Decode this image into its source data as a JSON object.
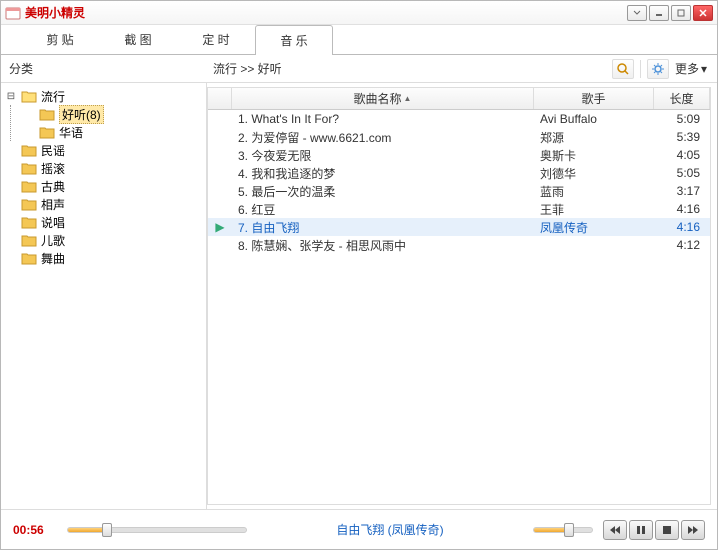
{
  "window": {
    "title": "美明小精灵"
  },
  "tabs": [
    {
      "label": "剪 贴",
      "active": false
    },
    {
      "label": "截 图",
      "active": false
    },
    {
      "label": "定 时",
      "active": false
    },
    {
      "label": "音 乐",
      "active": true
    }
  ],
  "toolbar": {
    "category_label": "分类",
    "breadcrumb": "流行 >> 好听",
    "more_label": "更多"
  },
  "tree": [
    {
      "label": "流行",
      "expanded": true,
      "children": [
        {
          "label": "好听(8)",
          "selected": true
        },
        {
          "label": "华语"
        }
      ]
    },
    {
      "label": "民谣"
    },
    {
      "label": "摇滚"
    },
    {
      "label": "古典"
    },
    {
      "label": "相声"
    },
    {
      "label": "说唱"
    },
    {
      "label": "儿歌"
    },
    {
      "label": "舞曲"
    }
  ],
  "columns": {
    "name": "歌曲名称",
    "artist": "歌手",
    "length": "长度"
  },
  "songs": [
    {
      "n": "1.",
      "name": "What's In It For?",
      "artist": "Avi Buffalo",
      "len": "5:09"
    },
    {
      "n": "2.",
      "name": "为爱停留 - www.6621.com",
      "artist": "郑源",
      "len": "5:39"
    },
    {
      "n": "3.",
      "name": "今夜爱无限",
      "artist": "奥斯卡",
      "len": "4:05"
    },
    {
      "n": "4.",
      "name": "我和我追逐的梦",
      "artist": "刘德华",
      "len": "5:05"
    },
    {
      "n": "5.",
      "name": "最后一次的温柔",
      "artist": "蓝雨",
      "len": "3:17"
    },
    {
      "n": "6.",
      "name": "红豆",
      "artist": "王菲",
      "len": "4:16"
    },
    {
      "n": "7.",
      "name": "自由飞翔",
      "artist": "凤凰传奇",
      "len": "4:16",
      "selected": true,
      "playing": true
    },
    {
      "n": "8.",
      "name": "陈慧娴、张学友 - 相思风雨中",
      "artist": "",
      "len": "4:12"
    }
  ],
  "player": {
    "time": "00:56",
    "progress_pct": 22,
    "nowplaying": "自由飞翔 (凤凰传奇)",
    "volume_pct": 60
  }
}
